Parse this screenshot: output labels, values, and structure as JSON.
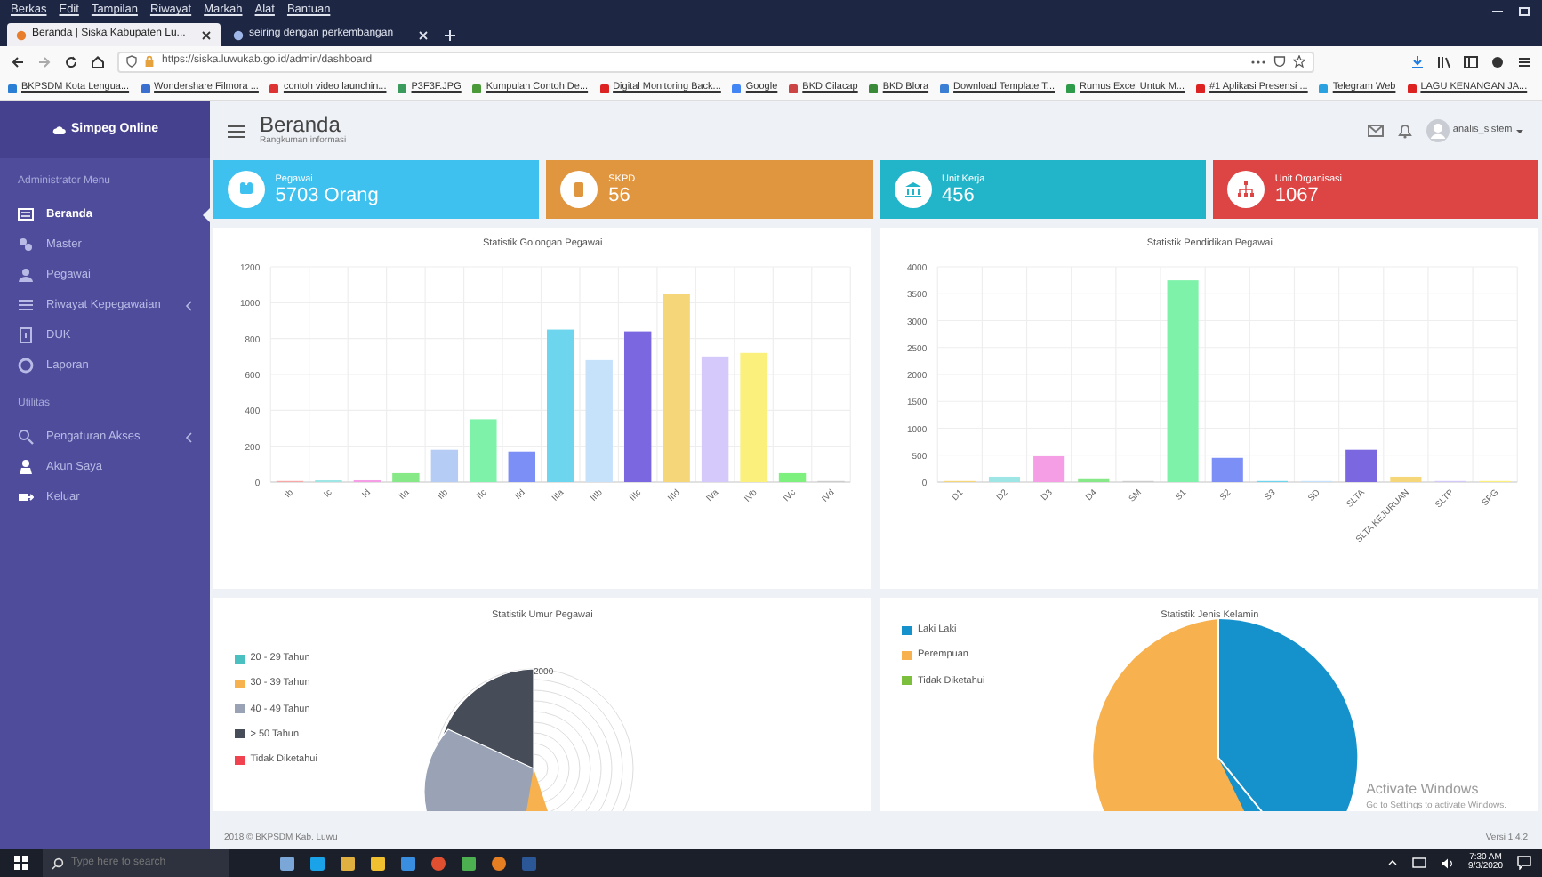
{
  "browser": {
    "menu": [
      "Berkas",
      "Edit",
      "Tampilan",
      "Riwayat",
      "Markah",
      "Alat",
      "Bantuan"
    ],
    "tabs": [
      {
        "label": "Beranda | Siska Kabupaten Lu...",
        "selected": true
      },
      {
        "label": "seiring dengan perkembangan",
        "selected": false
      }
    ],
    "url": "https://siska.luwukab.go.id/admin/dashboard",
    "bookmarks": [
      "BKPSDM Kota Lengua...",
      "Wondershare Filmora ...",
      "contoh video launchin...",
      "P3F3F.JPG",
      "Kumpulan Contoh De...",
      "Digital Monitoring Back...",
      "Google",
      "BKD Cilacap",
      "BKD Blora",
      "Download Template T...",
      "Rumus Excel Untuk M...",
      "#1 Aplikasi Presensi ...",
      "Telegram Web",
      "LAGU KENANGAN JA..."
    ]
  },
  "sidebar": {
    "brand": "Simpeg Online",
    "sections": [
      {
        "title": "Administrator Menu",
        "items": [
          {
            "label": "Beranda",
            "selected": true,
            "expandable": false
          },
          {
            "label": "Master",
            "selected": false,
            "expandable": false
          },
          {
            "label": "Pegawai",
            "selected": false,
            "expandable": false
          },
          {
            "label": "Riwayat Kepegawaian",
            "selected": false,
            "expandable": true
          },
          {
            "label": "DUK",
            "selected": false,
            "expandable": false
          },
          {
            "label": "Laporan",
            "selected": false,
            "expandable": false
          }
        ]
      },
      {
        "title": "Utilitas",
        "items": [
          {
            "label": "Pengaturan Akses",
            "selected": false,
            "expandable": true
          },
          {
            "label": "Akun Saya",
            "selected": false,
            "expandable": false
          },
          {
            "label": "Keluar",
            "selected": false,
            "expandable": false
          }
        ]
      }
    ]
  },
  "header": {
    "title": "Beranda",
    "subtitle": "Rangkuman informasi",
    "user": "analis_sistem"
  },
  "stats": [
    {
      "label": "Pegawai",
      "value": "5703 Orang",
      "color": "#3ec1ee"
    },
    {
      "label": "SKPD",
      "value": "56",
      "color": "#e0953f"
    },
    {
      "label": "Unit Kerja",
      "value": "456",
      "color": "#22b5c9"
    },
    {
      "label": "Unit Organisasi",
      "value": "1067",
      "color": "#dd4444"
    }
  ],
  "charts": [
    {
      "chart_data": {
        "type": "bar",
        "title": "Statistik Golongan Pegawai",
        "categories": [
          "Ib",
          "Ic",
          "Id",
          "IIa",
          "IIb",
          "IIc",
          "IId",
          "IIIa",
          "IIIb",
          "IIIc",
          "IIId",
          "IVa",
          "IVb",
          "IVc",
          "IVd"
        ],
        "ylim": [
          0,
          1200
        ],
        "yticks": [
          0,
          200,
          400,
          600,
          800,
          1000,
          1200
        ],
        "grid": true,
        "series": [
          {
            "values": [
              0,
              10,
              10,
              50,
              180,
              350,
              170,
              850,
              680,
              840,
              1050,
              700,
              720,
              50,
              0
            ],
            "colors": [
              "#f7a7a7",
              "#9ee6e6",
              "#f59ee6",
              "#86e886",
              "#b5cdf5",
              "#7ef2a8",
              "#7b8ff7",
              "#6dd5ed",
              "#c6e2fa",
              "#7b68e0",
              "#f5d77a",
              "#d4c9fa",
              "#fbf07c",
              "#7ef07e",
              "#cccccc"
            ]
          }
        ]
      }
    },
    {
      "chart_data": {
        "type": "bar",
        "title": "Statistik Pendidikan Pegawai",
        "categories": [
          "D1",
          "D2",
          "D3",
          "D4",
          "SM",
          "S1",
          "S2",
          "S3",
          "SD",
          "SLTA",
          "SLTA KEJURUAN",
          "SLTP",
          "SPG"
        ],
        "ylim": [
          0,
          4000
        ],
        "yticks": [
          0,
          500,
          1000,
          1500,
          2000,
          2500,
          3000,
          3500,
          4000
        ],
        "grid": true,
        "series": [
          {
            "values": [
              0,
              100,
              480,
              70,
              0,
              3750,
              450,
              0,
              0,
              600,
              100,
              0,
              0
            ],
            "colors": [
              "#f5d77a",
              "#9ee6e6",
              "#f59ee6",
              "#86e886",
              "#cccccc",
              "#7ef2a8",
              "#7b8ff7",
              "#6dd5ed",
              "#c6e2fa",
              "#7b68e0",
              "#f5d77a",
              "#d4c9fa",
              "#fbf07c"
            ]
          }
        ]
      }
    }
  ],
  "pies": [
    {
      "kind": "polar",
      "title": "Statistik Umur Pegawai",
      "scale_label": "2000",
      "legend": [
        {
          "label": "20 - 29 Tahun",
          "color": "#4bc0c0"
        },
        {
          "label": "30 - 39 Tahun",
          "color": "#f7b24f"
        },
        {
          "label": "40 - 49 Tahun",
          "color": "#9aa3b5"
        },
        {
          "label": "> 50 Tahun",
          "color": "#474c59"
        },
        {
          "label": "Tidak Diketahui",
          "color": "#f0434f"
        }
      ]
    },
    {
      "kind": "pie",
      "title": "Statistik Jenis Kelamin",
      "legend": [
        {
          "label": "Laki Laki",
          "color": "#1592cc"
        },
        {
          "label": "Perempuan",
          "color": "#f7b24f"
        },
        {
          "label": "Tidak Diketahui",
          "color": "#7bbf3c"
        }
      ]
    }
  ],
  "footer": {
    "copyright": "2018 © BKPSDM Kab. Luwu",
    "version": "Versi 1.4.2"
  },
  "activation": {
    "title": "Activate Windows",
    "subtitle": "Go to Settings to activate Windows."
  },
  "taskbar": {
    "search_placeholder": "Type here to search",
    "time": "7:30 AM",
    "date": "9/3/2020"
  }
}
